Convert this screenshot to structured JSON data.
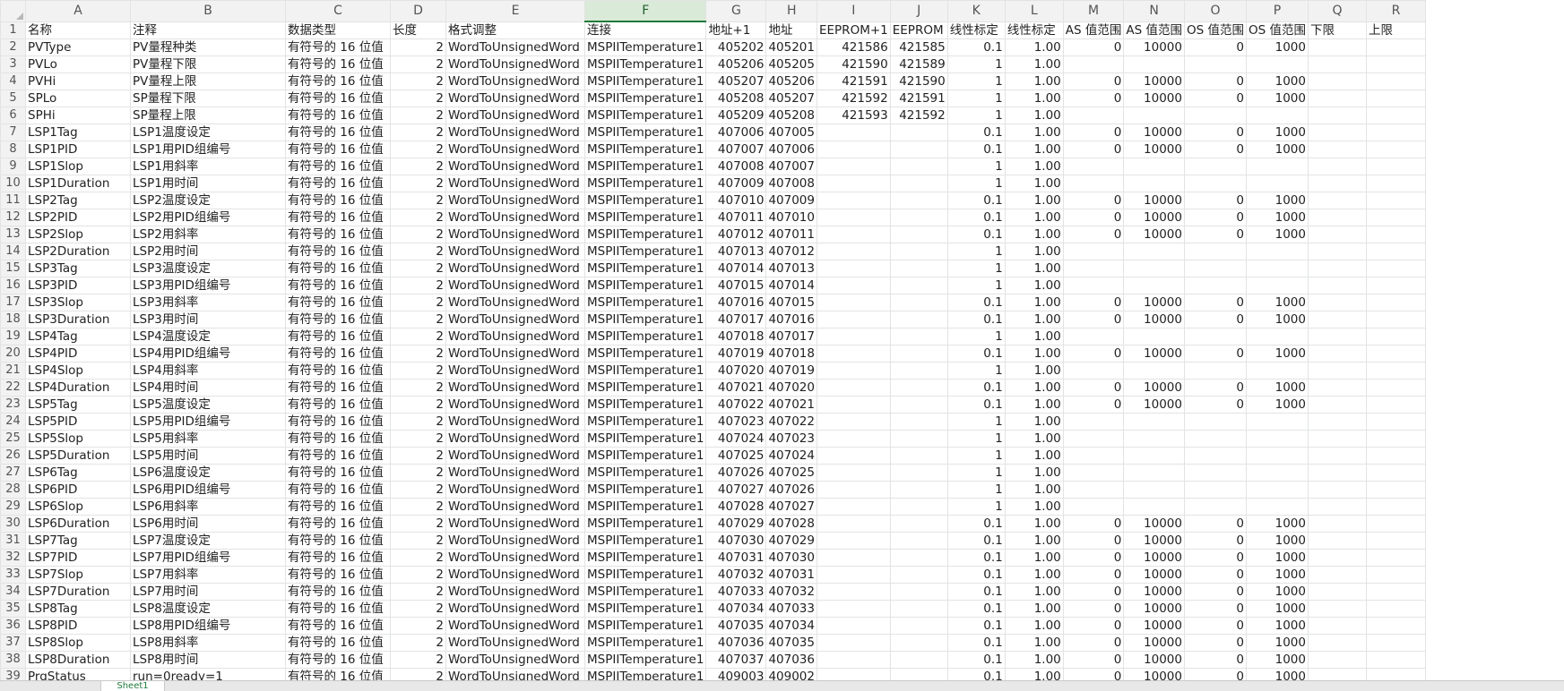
{
  "column_letters": [
    "A",
    "B",
    "C",
    "D",
    "E",
    "F",
    "G",
    "H",
    "I",
    "J",
    "K",
    "L",
    "M",
    "N",
    "O",
    "P",
    "Q",
    "R"
  ],
  "selected_column": "F",
  "rows": [
    {
      "n": "1",
      "c": [
        "名称",
        "注释",
        "数据类型",
        "长度",
        "格式调整",
        "连接",
        "地址+1",
        "地址",
        "EEPROM+1",
        "EEPROM",
        "线性标定",
        "线性标定",
        "AS 值范围",
        "AS 值范围",
        "OS 值范围",
        "OS 值范围",
        "下限",
        "上限"
      ]
    },
    {
      "n": "2",
      "c": [
        "PVType",
        "PV量程种类",
        "有符号的 16 位值",
        "2",
        "WordToUnsignedWord",
        "MSPIITemperature1",
        "405202",
        "405201",
        "421586",
        "421585",
        "0.1",
        "1.00",
        "0",
        "10000",
        "0",
        "1000",
        "",
        ""
      ]
    },
    {
      "n": "3",
      "c": [
        "PVLo",
        "PV量程下限",
        "有符号的 16 位值",
        "2",
        "WordToUnsignedWord",
        "MSPIITemperature1",
        "405206",
        "405205",
        "421590",
        "421589",
        "1",
        "1.00",
        "",
        "",
        "",
        "",
        "",
        ""
      ]
    },
    {
      "n": "4",
      "c": [
        "PVHi",
        "PV量程上限",
        "有符号的 16 位值",
        "2",
        "WordToUnsignedWord",
        "MSPIITemperature1",
        "405207",
        "405206",
        "421591",
        "421590",
        "1",
        "1.00",
        "0",
        "10000",
        "0",
        "1000",
        "",
        ""
      ]
    },
    {
      "n": "5",
      "c": [
        "SPLo",
        "SP量程下限",
        "有符号的 16 位值",
        "2",
        "WordToUnsignedWord",
        "MSPIITemperature1",
        "405208",
        "405207",
        "421592",
        "421591",
        "1",
        "1.00",
        "0",
        "10000",
        "0",
        "1000",
        "",
        ""
      ]
    },
    {
      "n": "6",
      "c": [
        "SPHi",
        "SP量程上限",
        "有符号的 16 位值",
        "2",
        "WordToUnsignedWord",
        "MSPIITemperature1",
        "405209",
        "405208",
        "421593",
        "421592",
        "1",
        "1.00",
        "",
        "",
        "",
        "",
        "",
        ""
      ]
    },
    {
      "n": "7",
      "c": [
        "LSP1Tag",
        "LSP1温度设定",
        "有符号的 16 位值",
        "2",
        "WordToUnsignedWord",
        "MSPIITemperature1",
        "407006",
        "407005",
        "",
        "",
        "0.1",
        "1.00",
        "0",
        "10000",
        "0",
        "1000",
        "",
        ""
      ]
    },
    {
      "n": "8",
      "c": [
        "LSP1PID",
        "LSP1用PID组编号",
        "有符号的 16 位值",
        "2",
        "WordToUnsignedWord",
        "MSPIITemperature1",
        "407007",
        "407006",
        "",
        "",
        "0.1",
        "1.00",
        "0",
        "10000",
        "0",
        "1000",
        "",
        ""
      ]
    },
    {
      "n": "9",
      "c": [
        "LSP1Slop",
        "LSP1用斜率",
        "有符号的 16 位值",
        "2",
        "WordToUnsignedWord",
        "MSPIITemperature1",
        "407008",
        "407007",
        "",
        "",
        "1",
        "1.00",
        "",
        "",
        "",
        "",
        "",
        ""
      ]
    },
    {
      "n": "10",
      "c": [
        "LSP1Duration",
        "LSP1用时间",
        "有符号的 16 位值",
        "2",
        "WordToUnsignedWord",
        "MSPIITemperature1",
        "407009",
        "407008",
        "",
        "",
        "1",
        "1.00",
        "",
        "",
        "",
        "",
        "",
        ""
      ]
    },
    {
      "n": "11",
      "c": [
        "LSP2Tag",
        "LSP2温度设定",
        "有符号的 16 位值",
        "2",
        "WordToUnsignedWord",
        "MSPIITemperature1",
        "407010",
        "407009",
        "",
        "",
        "0.1",
        "1.00",
        "0",
        "10000",
        "0",
        "1000",
        "",
        ""
      ]
    },
    {
      "n": "12",
      "c": [
        "LSP2PID",
        "LSP2用PID组编号",
        "有符号的 16 位值",
        "2",
        "WordToUnsignedWord",
        "MSPIITemperature1",
        "407011",
        "407010",
        "",
        "",
        "0.1",
        "1.00",
        "0",
        "10000",
        "0",
        "1000",
        "",
        ""
      ]
    },
    {
      "n": "13",
      "c": [
        "LSP2Slop",
        "LSP2用斜率",
        "有符号的 16 位值",
        "2",
        "WordToUnsignedWord",
        "MSPIITemperature1",
        "407012",
        "407011",
        "",
        "",
        "0.1",
        "1.00",
        "0",
        "10000",
        "0",
        "1000",
        "",
        ""
      ]
    },
    {
      "n": "14",
      "c": [
        "LSP2Duration",
        "LSP2用时间",
        "有符号的 16 位值",
        "2",
        "WordToUnsignedWord",
        "MSPIITemperature1",
        "407013",
        "407012",
        "",
        "",
        "1",
        "1.00",
        "",
        "",
        "",
        "",
        "",
        ""
      ]
    },
    {
      "n": "15",
      "c": [
        "LSP3Tag",
        "LSP3温度设定",
        "有符号的 16 位值",
        "2",
        "WordToUnsignedWord",
        "MSPIITemperature1",
        "407014",
        "407013",
        "",
        "",
        "1",
        "1.00",
        "",
        "",
        "",
        "",
        "",
        ""
      ]
    },
    {
      "n": "16",
      "c": [
        "LSP3PID",
        "LSP3用PID组编号",
        "有符号的 16 位值",
        "2",
        "WordToUnsignedWord",
        "MSPIITemperature1",
        "407015",
        "407014",
        "",
        "",
        "1",
        "1.00",
        "",
        "",
        "",
        "",
        "",
        ""
      ]
    },
    {
      "n": "17",
      "c": [
        "LSP3Slop",
        "LSP3用斜率",
        "有符号的 16 位值",
        "2",
        "WordToUnsignedWord",
        "MSPIITemperature1",
        "407016",
        "407015",
        "",
        "",
        "0.1",
        "1.00",
        "0",
        "10000",
        "0",
        "1000",
        "",
        ""
      ]
    },
    {
      "n": "18",
      "c": [
        "LSP3Duration",
        "LSP3用时间",
        "有符号的 16 位值",
        "2",
        "WordToUnsignedWord",
        "MSPIITemperature1",
        "407017",
        "407016",
        "",
        "",
        "0.1",
        "1.00",
        "0",
        "10000",
        "0",
        "1000",
        "",
        ""
      ]
    },
    {
      "n": "19",
      "c": [
        "LSP4Tag",
        "LSP4温度设定",
        "有符号的 16 位值",
        "2",
        "WordToUnsignedWord",
        "MSPIITemperature1",
        "407018",
        "407017",
        "",
        "",
        "1",
        "1.00",
        "",
        "",
        "",
        "",
        "",
        ""
      ]
    },
    {
      "n": "20",
      "c": [
        "LSP4PID",
        "LSP4用PID组编号",
        "有符号的 16 位值",
        "2",
        "WordToUnsignedWord",
        "MSPIITemperature1",
        "407019",
        "407018",
        "",
        "",
        "0.1",
        "1.00",
        "0",
        "10000",
        "0",
        "1000",
        "",
        ""
      ]
    },
    {
      "n": "21",
      "c": [
        "LSP4Slop",
        "LSP4用斜率",
        "有符号的 16 位值",
        "2",
        "WordToUnsignedWord",
        "MSPIITemperature1",
        "407020",
        "407019",
        "",
        "",
        "1",
        "1.00",
        "",
        "",
        "",
        "",
        "",
        ""
      ]
    },
    {
      "n": "22",
      "c": [
        "LSP4Duration",
        "LSP4用时间",
        "有符号的 16 位值",
        "2",
        "WordToUnsignedWord",
        "MSPIITemperature1",
        "407021",
        "407020",
        "",
        "",
        "0.1",
        "1.00",
        "0",
        "10000",
        "0",
        "1000",
        "",
        ""
      ]
    },
    {
      "n": "23",
      "c": [
        "LSP5Tag",
        "LSP5温度设定",
        "有符号的 16 位值",
        "2",
        "WordToUnsignedWord",
        "MSPIITemperature1",
        "407022",
        "407021",
        "",
        "",
        "0.1",
        "1.00",
        "0",
        "10000",
        "0",
        "1000",
        "",
        ""
      ]
    },
    {
      "n": "24",
      "c": [
        "LSP5PID",
        "LSP5用PID组编号",
        "有符号的 16 位值",
        "2",
        "WordToUnsignedWord",
        "MSPIITemperature1",
        "407023",
        "407022",
        "",
        "",
        "1",
        "1.00",
        "",
        "",
        "",
        "",
        "",
        ""
      ]
    },
    {
      "n": "25",
      "c": [
        "LSP5Slop",
        "LSP5用斜率",
        "有符号的 16 位值",
        "2",
        "WordToUnsignedWord",
        "MSPIITemperature1",
        "407024",
        "407023",
        "",
        "",
        "1",
        "1.00",
        "",
        "",
        "",
        "",
        "",
        ""
      ]
    },
    {
      "n": "26",
      "c": [
        "LSP5Duration",
        "LSP5用时间",
        "有符号的 16 位值",
        "2",
        "WordToUnsignedWord",
        "MSPIITemperature1",
        "407025",
        "407024",
        "",
        "",
        "1",
        "1.00",
        "",
        "",
        "",
        "",
        "",
        ""
      ]
    },
    {
      "n": "27",
      "c": [
        "LSP6Tag",
        "LSP6温度设定",
        "有符号的 16 位值",
        "2",
        "WordToUnsignedWord",
        "MSPIITemperature1",
        "407026",
        "407025",
        "",
        "",
        "1",
        "1.00",
        "",
        "",
        "",
        "",
        "",
        ""
      ]
    },
    {
      "n": "28",
      "c": [
        "LSP6PID",
        "LSP6用PID组编号",
        "有符号的 16 位值",
        "2",
        "WordToUnsignedWord",
        "MSPIITemperature1",
        "407027",
        "407026",
        "",
        "",
        "1",
        "1.00",
        "",
        "",
        "",
        "",
        "",
        ""
      ]
    },
    {
      "n": "29",
      "c": [
        "LSP6Slop",
        "LSP6用斜率",
        "有符号的 16 位值",
        "2",
        "WordToUnsignedWord",
        "MSPIITemperature1",
        "407028",
        "407027",
        "",
        "",
        "1",
        "1.00",
        "",
        "",
        "",
        "",
        "",
        ""
      ]
    },
    {
      "n": "30",
      "c": [
        "LSP6Duration",
        "LSP6用时间",
        "有符号的 16 位值",
        "2",
        "WordToUnsignedWord",
        "MSPIITemperature1",
        "407029",
        "407028",
        "",
        "",
        "0.1",
        "1.00",
        "0",
        "10000",
        "0",
        "1000",
        "",
        ""
      ]
    },
    {
      "n": "31",
      "c": [
        "LSP7Tag",
        "LSP7温度设定",
        "有符号的 16 位值",
        "2",
        "WordToUnsignedWord",
        "MSPIITemperature1",
        "407030",
        "407029",
        "",
        "",
        "0.1",
        "1.00",
        "0",
        "10000",
        "0",
        "1000",
        "",
        ""
      ]
    },
    {
      "n": "32",
      "c": [
        "LSP7PID",
        "LSP7用PID组编号",
        "有符号的 16 位值",
        "2",
        "WordToUnsignedWord",
        "MSPIITemperature1",
        "407031",
        "407030",
        "",
        "",
        "0.1",
        "1.00",
        "0",
        "10000",
        "0",
        "1000",
        "",
        ""
      ]
    },
    {
      "n": "33",
      "c": [
        "LSP7Slop",
        "LSP7用斜率",
        "有符号的 16 位值",
        "2",
        "WordToUnsignedWord",
        "MSPIITemperature1",
        "407032",
        "407031",
        "",
        "",
        "0.1",
        "1.00",
        "0",
        "10000",
        "0",
        "1000",
        "",
        ""
      ]
    },
    {
      "n": "34",
      "c": [
        "LSP7Duration",
        "LSP7用时间",
        "有符号的 16 位值",
        "2",
        "WordToUnsignedWord",
        "MSPIITemperature1",
        "407033",
        "407032",
        "",
        "",
        "0.1",
        "1.00",
        "0",
        "10000",
        "0",
        "1000",
        "",
        ""
      ]
    },
    {
      "n": "35",
      "c": [
        "LSP8Tag",
        "LSP8温度设定",
        "有符号的 16 位值",
        "2",
        "WordToUnsignedWord",
        "MSPIITemperature1",
        "407034",
        "407033",
        "",
        "",
        "0.1",
        "1.00",
        "0",
        "10000",
        "0",
        "1000",
        "",
        ""
      ]
    },
    {
      "n": "36",
      "c": [
        "LSP8PID",
        "LSP8用PID组编号",
        "有符号的 16 位值",
        "2",
        "WordToUnsignedWord",
        "MSPIITemperature1",
        "407035",
        "407034",
        "",
        "",
        "0.1",
        "1.00",
        "0",
        "10000",
        "0",
        "1000",
        "",
        ""
      ]
    },
    {
      "n": "37",
      "c": [
        "LSP8Slop",
        "LSP8用斜率",
        "有符号的 16 位值",
        "2",
        "WordToUnsignedWord",
        "MSPIITemperature1",
        "407036",
        "407035",
        "",
        "",
        "0.1",
        "1.00",
        "0",
        "10000",
        "0",
        "1000",
        "",
        ""
      ]
    },
    {
      "n": "38",
      "c": [
        "LSP8Duration",
        "LSP8用时间",
        "有符号的 16 位值",
        "2",
        "WordToUnsignedWord",
        "MSPIITemperature1",
        "407037",
        "407036",
        "",
        "",
        "0.1",
        "1.00",
        "0",
        "10000",
        "0",
        "1000",
        "",
        ""
      ]
    },
    {
      "n": "39",
      "c": [
        "PrgStatus",
        "run=0ready=1",
        "有符号的 16 位值",
        "2",
        "WordToUnsignedWord",
        "MSPIITemperature1",
        "409003",
        "409002",
        "",
        "",
        "0.1",
        "1.00",
        "0",
        "10000",
        "0",
        "1000",
        "",
        ""
      ]
    }
  ],
  "sheet_tab": "Sheet1"
}
